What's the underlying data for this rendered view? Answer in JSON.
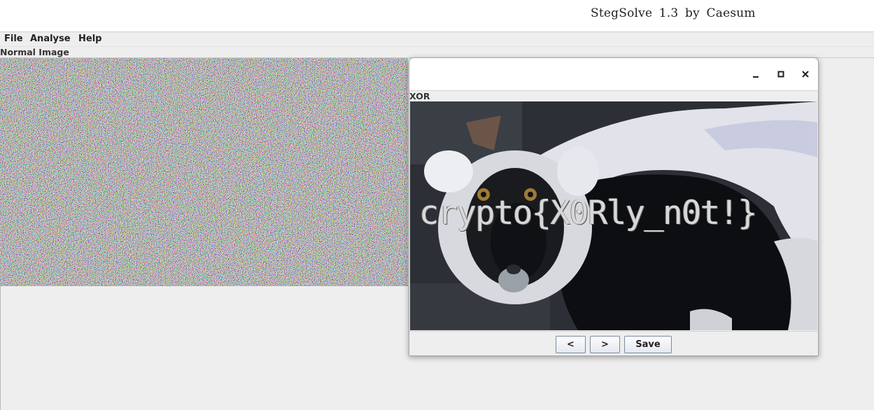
{
  "window": {
    "title": "StegSolve 1.3 by Caesum"
  },
  "menu": {
    "items": [
      {
        "label": "File"
      },
      {
        "label": "Analyse"
      },
      {
        "label": "Help"
      }
    ]
  },
  "main": {
    "image_label": "Normal Image"
  },
  "child_window": {
    "panel_label": "XOR",
    "flag_text": "crypto{X0Rly_n0t!}",
    "controls": {
      "minimize_icon": "minimize-icon",
      "maximize_icon": "maximize-icon",
      "close_icon": "close-icon"
    },
    "buttons": {
      "prev": "<",
      "next": ">",
      "save": "Save"
    }
  }
}
